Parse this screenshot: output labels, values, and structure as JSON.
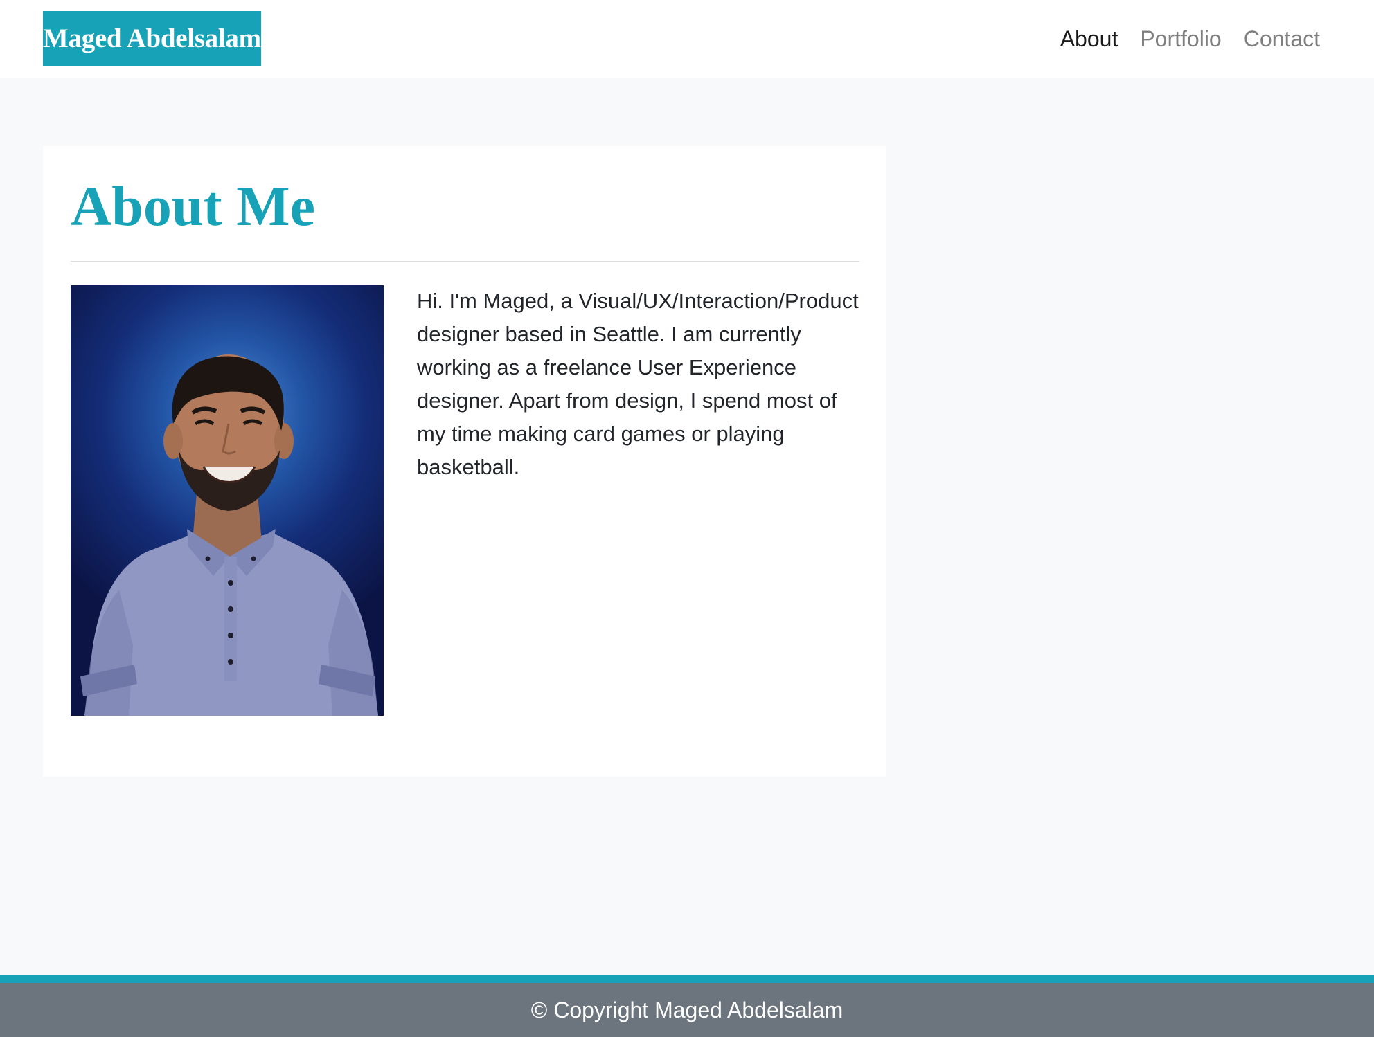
{
  "navbar": {
    "brand": "Maged Abdelsalam",
    "links": [
      {
        "label": "About",
        "active": true
      },
      {
        "label": "Portfolio",
        "active": false
      },
      {
        "label": "Contact",
        "active": false
      }
    ]
  },
  "about": {
    "title": "About Me",
    "bio": "Hi. I'm Maged, a Visual/UX/Interaction/Product designer based in Seattle. I am currently working as a freelance User Experience designer. Apart from design, I spend most of my time making card games or playing basketball."
  },
  "footer": {
    "copyright": "© Copyright Maged Abdelsalam"
  },
  "colors": {
    "accent": "#17a2b8",
    "page_bg": "#f8f9fa",
    "footer_bg": "#6c757d",
    "text": "#212529"
  }
}
